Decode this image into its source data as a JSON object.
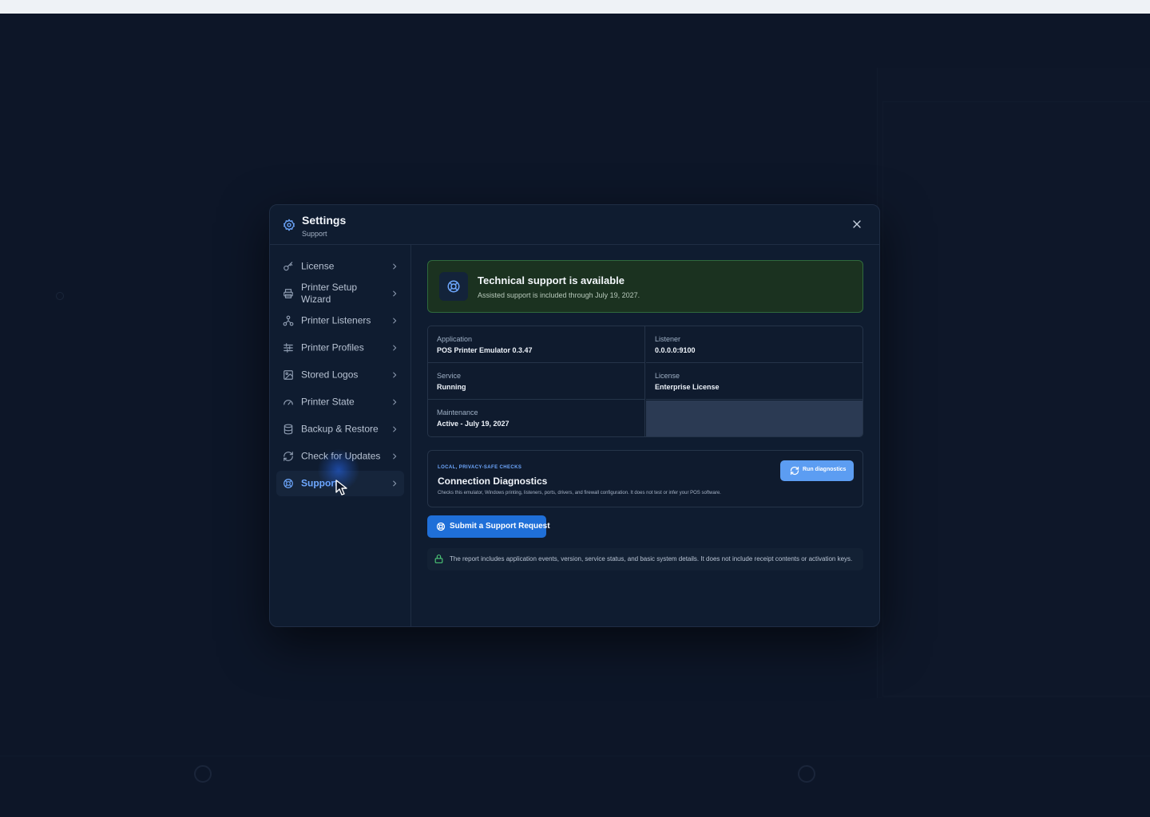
{
  "modal": {
    "title": "Settings",
    "subtitle": "Support"
  },
  "sidebar": {
    "items": [
      {
        "label": "License",
        "icon": "key-icon"
      },
      {
        "label": "Printer Setup Wizard",
        "icon": "printer-icon"
      },
      {
        "label": "Printer Listeners",
        "icon": "network-icon"
      },
      {
        "label": "Printer Profiles",
        "icon": "sliders-icon"
      },
      {
        "label": "Stored Logos",
        "icon": "image-icon"
      },
      {
        "label": "Printer State",
        "icon": "gauge-icon"
      },
      {
        "label": "Backup & Restore",
        "icon": "database-icon"
      },
      {
        "label": "Check for Updates",
        "icon": "refresh-icon"
      },
      {
        "label": "Support",
        "icon": "lifebuoy-icon",
        "active": true
      }
    ]
  },
  "banner": {
    "title": "Technical support is available",
    "text": "Assisted support is included through July 19, 2027."
  },
  "info": {
    "application": {
      "label": "Application",
      "value": "POS Printer Emulator 0.3.47"
    },
    "listener": {
      "label": "Listener",
      "value": "0.0.0.0:9100"
    },
    "service": {
      "label": "Service",
      "value": "Running"
    },
    "license": {
      "label": "License",
      "value": "Enterprise License"
    },
    "maintenance": {
      "label": "Maintenance",
      "value": "Active - July 19, 2027"
    }
  },
  "diagnostics": {
    "tag": "Local, privacy-safe checks",
    "title": "Connection Diagnostics",
    "text": "Checks this emulator, Windows printing, listeners, ports, drivers, and firewall configuration. It does not test or infer your POS software.",
    "button_label": "Run diagnostics"
  },
  "support_button_label": "Submit a Support Request",
  "privacy_note": "The report includes application events, version, service status, and basic system details. It does not include receipt contents or activation keys.",
  "colors": {
    "accent": "#1f6fd8",
    "accent_light": "#5c9df2",
    "active_nav": "#6ea8ff",
    "success_bg": "#1b3220",
    "success_border": "#2f6a3c"
  }
}
